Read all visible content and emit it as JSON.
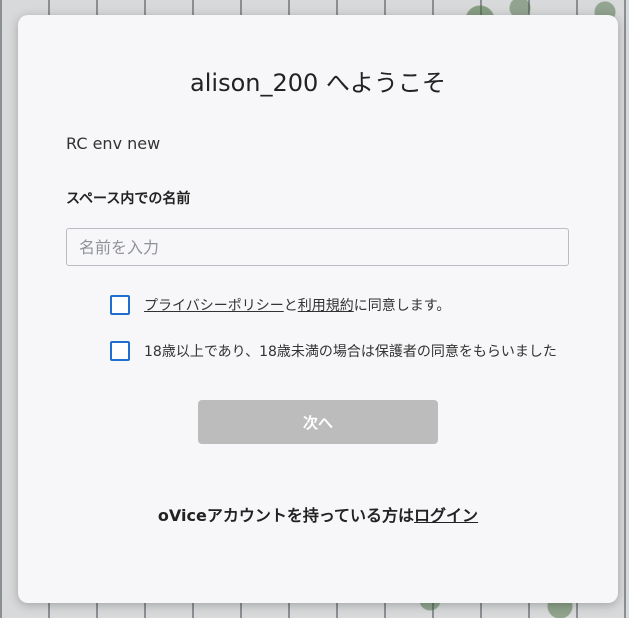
{
  "dialog": {
    "title": "alison_200 へようこそ",
    "space_name": "RC env new",
    "name_label": "スペース内での名前",
    "name_input": {
      "placeholder": "名前を入力",
      "value": ""
    },
    "consent": {
      "privacy_link": "プライバシーポリシー",
      "and": "と",
      "terms_link": "利用規約",
      "suffix": "に同意します。",
      "checked": false
    },
    "age_confirm": {
      "text": "18歳以上であり、18歳未満の場合は保護者の同意をもらいました",
      "checked": false
    },
    "next_button": "次へ",
    "footer": {
      "text": "oViceアカウントを持っている方は",
      "login_link": "ログイン"
    }
  },
  "colors": {
    "checkbox_border": "#1f6fd1",
    "button_disabled": "#bcbcbc",
    "modal_bg": "#f7f7f9"
  }
}
